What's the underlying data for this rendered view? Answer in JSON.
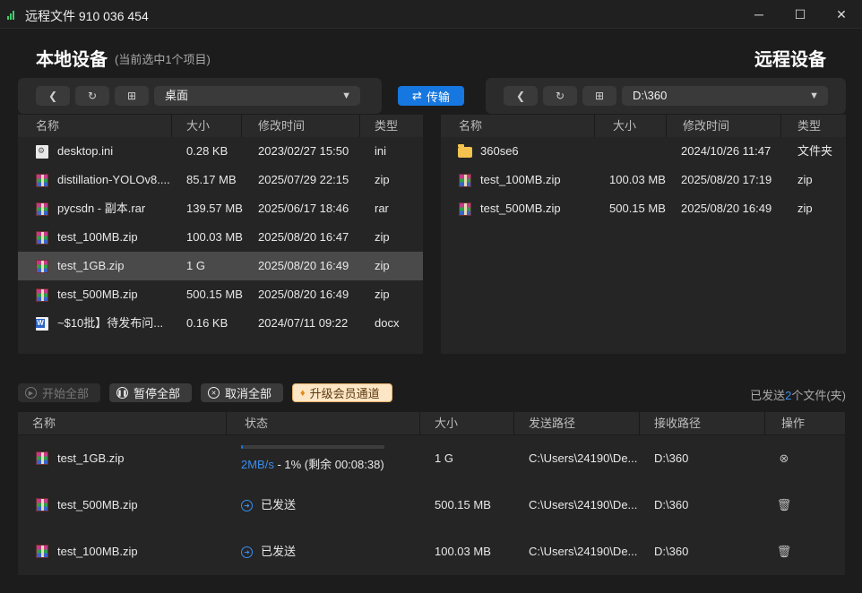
{
  "window": {
    "title": "远程文件 910 036 454",
    "minimize_glyph": "─",
    "maximize_glyph": "☐",
    "close_glyph": "✕"
  },
  "local": {
    "heading": "本地设备",
    "selection_hint": "(当前选中1个项目)",
    "path": "桌面",
    "columns": [
      "名称",
      "大小",
      "修改时间",
      "类型"
    ],
    "files": [
      {
        "name": "desktop.ini",
        "size": "0.28 KB",
        "modified": "2023/02/27 15:50",
        "type": "ini",
        "icon": "ini-file-icon"
      },
      {
        "name": "distillation-YOLOv8....",
        "size": "85.17 MB",
        "modified": "2025/07/29 22:15",
        "type": "zip",
        "icon": "archive-icon"
      },
      {
        "name": "pycsdn - 副本.rar",
        "size": "139.57 MB",
        "modified": "2025/06/17 18:46",
        "type": "rar",
        "icon": "archive-icon"
      },
      {
        "name": "test_100MB.zip",
        "size": "100.03 MB",
        "modified": "2025/08/20 16:47",
        "type": "zip",
        "icon": "archive-icon"
      },
      {
        "name": "test_1GB.zip",
        "size": "1 G",
        "modified": "2025/08/20 16:49",
        "type": "zip",
        "icon": "archive-icon",
        "selected": true
      },
      {
        "name": "test_500MB.zip",
        "size": "500.15 MB",
        "modified": "2025/08/20 16:49",
        "type": "zip",
        "icon": "archive-icon"
      },
      {
        "name": "~$10批】待发布问...",
        "size": "0.16 KB",
        "modified": "2024/07/11 09:22",
        "type": "docx",
        "icon": "word-doc-icon"
      }
    ]
  },
  "remote": {
    "heading": "远程设备",
    "path": "D:\\360",
    "columns": [
      "名称",
      "大小",
      "修改时间",
      "类型"
    ],
    "files": [
      {
        "name": "360se6",
        "size": "",
        "modified": "2024/10/26 11:47",
        "type": "文件夹",
        "icon": "folder-icon"
      },
      {
        "name": "test_100MB.zip",
        "size": "100.03 MB",
        "modified": "2025/08/20 17:19",
        "type": "zip",
        "icon": "archive-icon"
      },
      {
        "name": "test_500MB.zip",
        "size": "500.15 MB",
        "modified": "2025/08/20 16:49",
        "type": "zip",
        "icon": "archive-icon"
      }
    ]
  },
  "transfer_button": {
    "label": "传输",
    "icon": "swap-arrows-icon"
  },
  "actions": {
    "start_all": "开始全部",
    "pause_all": "暂停全部",
    "cancel_all": "取消全部",
    "upgrade": "升级会员通道",
    "sent_prefix": "已发送",
    "sent_count": "2",
    "sent_suffix": "个文件(夹)"
  },
  "transfers": {
    "columns": [
      "名称",
      "状态",
      "大小",
      "发送路径",
      "接收路径",
      "操作"
    ],
    "items": [
      {
        "name": "test_1GB.zip",
        "status": "",
        "speed": "2MB/s",
        "progress_detail": " - 1% (剩余 00:08:38)",
        "progress": 0.01,
        "size": "1 G",
        "src": "C:\\Users\\24190\\De...",
        "dst": "D:\\360",
        "op_icon": "cancel-circle-icon"
      },
      {
        "name": "test_500MB.zip",
        "status": "已发送",
        "size": "500.15 MB",
        "src": "C:\\Users\\24190\\De...",
        "dst": "D:\\360",
        "op_icon": "trash-icon"
      },
      {
        "name": "test_100MB.zip",
        "status": "已发送",
        "size": "100.03 MB",
        "src": "C:\\Users\\24190\\De...",
        "dst": "D:\\360",
        "op_icon": "trash-icon"
      }
    ]
  },
  "colors": {
    "accent": "#1677e0",
    "selected_row": "#4a4a4a",
    "background": "#1c1c1c"
  }
}
